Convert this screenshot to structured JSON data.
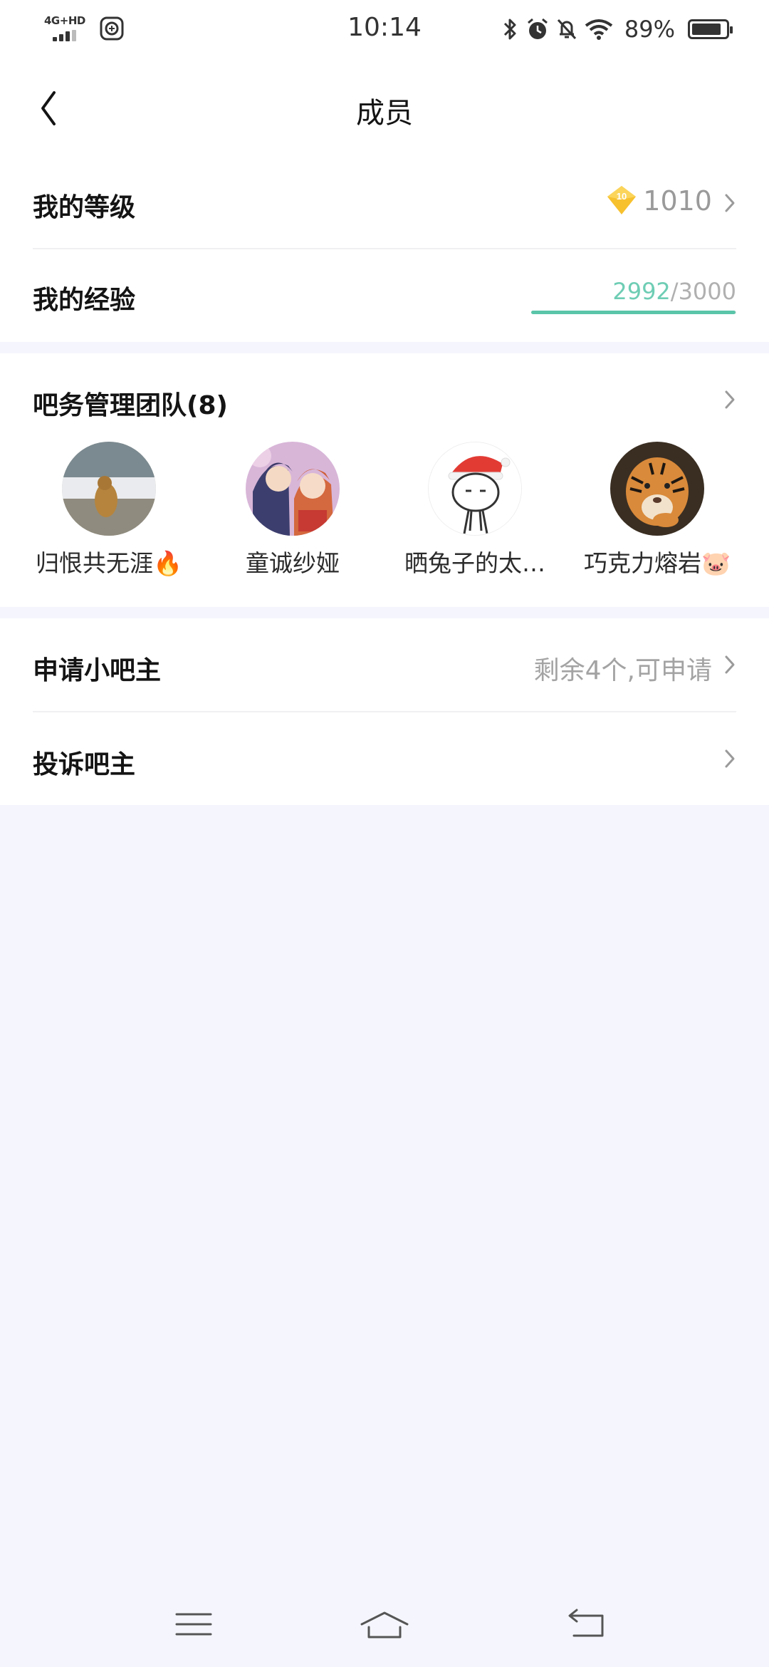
{
  "status_bar": {
    "network": "4G+HD",
    "time": "10:14",
    "battery_percent": "89%",
    "battery_level": 0.89,
    "icons": [
      "signal-icon",
      "app-notification-icon",
      "bluetooth-icon",
      "alarm-icon",
      "mute-icon",
      "wifi-icon",
      "battery-icon"
    ]
  },
  "header": {
    "title": "成员",
    "back_icon": "back-arrow-icon"
  },
  "level_row": {
    "label": "我的等级",
    "badge_level": "10",
    "value": "1010",
    "badge_color": "#f7c12e"
  },
  "exp_row": {
    "label": "我的经验",
    "current": "2992",
    "separator": "/",
    "max": "3000",
    "progress": 0.9973,
    "accent_color": "#5ac5a8"
  },
  "team": {
    "title": "吧务管理团队(8)",
    "members": [
      {
        "name": "归恨共无涯🔥",
        "avatar": "avatar-landscape-photo"
      },
      {
        "name": "童诚纱娅",
        "avatar": "avatar-anime-couple"
      },
      {
        "name": "晒兔子的太…",
        "avatar": "avatar-santa-hat-cartoon"
      },
      {
        "name": "巧克力熔岩🐷",
        "avatar": "avatar-tiger-photo"
      }
    ]
  },
  "apply_row": {
    "label": "申请小吧主",
    "hint": "剩余4个,可申请"
  },
  "complain_row": {
    "label": "投诉吧主"
  },
  "nav_bar": {
    "icons": [
      "menu-icon",
      "home-icon",
      "back-icon"
    ]
  }
}
